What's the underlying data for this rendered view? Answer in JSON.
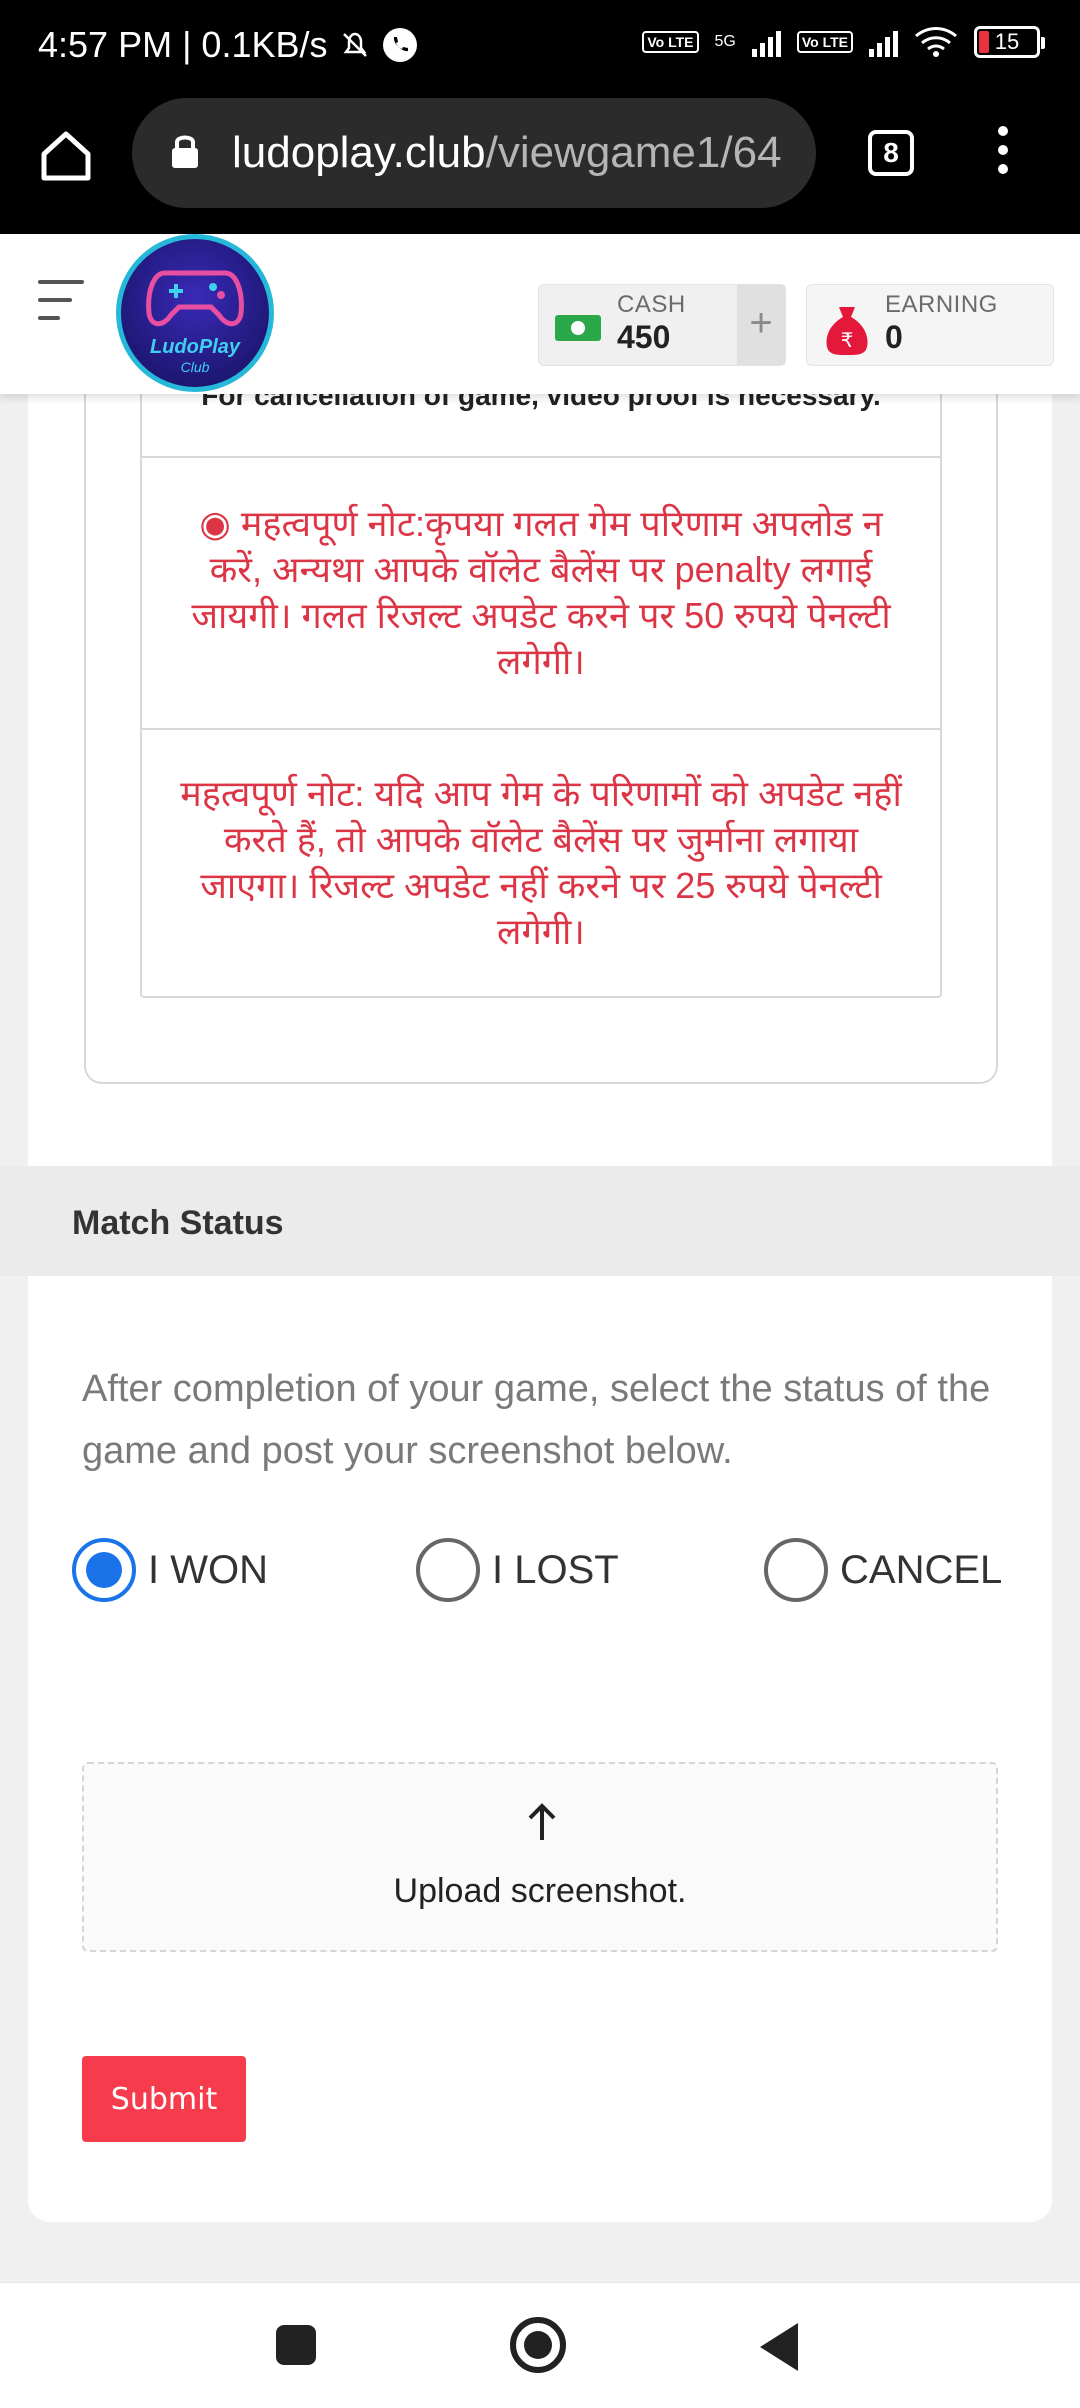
{
  "status_bar": {
    "time_speed": "4:57 PM | 0.1KB/s",
    "network_5g": "5G",
    "volte_label": "Vo LTE",
    "battery": "15"
  },
  "browser": {
    "url_domain": "ludoplay.club",
    "url_path": "/viewgame1/64",
    "tab_count": "8"
  },
  "header": {
    "logo_text": "LudoPlay",
    "logo_sub": "Club",
    "cash_label": "CASH",
    "cash_value": "450",
    "plus_label": "+",
    "earning_label": "EARNING",
    "earning_value": "0"
  },
  "rules": {
    "cut_text": "For cancellation of game, video proof is necessary.",
    "note1": "◉ महत्वपूर्ण नोट:कृपया गलत गेम परिणाम अपलोड न करें, अन्यथा आपके वॉलेट बैलेंस पर penalty लगाई जायगी। गलत रिजल्ट अपडेट करने पर 50 रुपये पेनल्टी लगेगी।",
    "note2": "महत्वपूर्ण नोट: यदि आप गेम के परिणामों को अपडेट नहीं करते हैं, तो आपके वॉलेट बैलेंस पर जुर्माना लगाया जाएगा। रिजल्ट अपडेट नहीं करने पर 25 रुपये पेनल्टी लगेगी।"
  },
  "match": {
    "title": "Match Status",
    "instructions": "After completion of your game, select the status of the game and post your screenshot below.",
    "options": [
      {
        "label": "I WON",
        "checked": true
      },
      {
        "label": "I LOST",
        "checked": false
      },
      {
        "label": "CANCEL",
        "checked": false
      }
    ],
    "upload_label": "Upload screenshot.",
    "submit_label": "Submit"
  },
  "colors": {
    "accent_red": "#f53b4c",
    "note_red": "#dc3545",
    "radio_blue": "#1a73e8"
  },
  "icons": [
    "home-icon",
    "lock-icon",
    "menu-dots-icon",
    "hamburger-icon",
    "cash-icon",
    "money-bag-icon",
    "upload-arrow-icon"
  ]
}
